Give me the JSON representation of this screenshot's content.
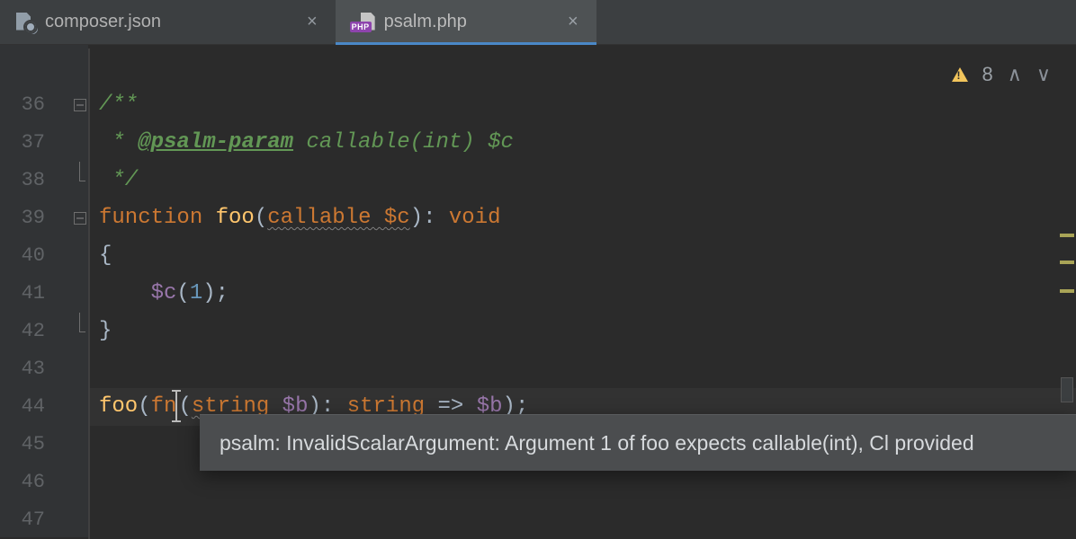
{
  "tabs": {
    "inactive": {
      "label": "composer.json"
    },
    "active": {
      "label": "psalm.php",
      "badge": "PHP"
    }
  },
  "inspections": {
    "warning_count": "8"
  },
  "gutter": {
    "l35": " ",
    "l36": "36",
    "l37": "37",
    "l38": "38",
    "l39": "39",
    "l40": "40",
    "l41": "41",
    "l42": "42",
    "l43": "43",
    "l44": "44",
    "l45": "45",
    "l46": "46",
    "l47": "47"
  },
  "code": {
    "l36": {
      "a": "/**"
    },
    "l37": {
      "a": " * ",
      "tag": "@psalm-param",
      "b": " callable(int) $c"
    },
    "l38": {
      "a": " */"
    },
    "l39": {
      "kw": "function ",
      "fn": "foo",
      "p1": "(",
      "param": "callable $c",
      "p2": "): ",
      "ret": "void"
    },
    "l40": {
      "a": "{"
    },
    "l41": {
      "pad": "    ",
      "var": "$c",
      "p1": "(",
      "num": "1",
      "p2": ");"
    },
    "l42": {
      "a": "}"
    },
    "l44": {
      "fn": "foo",
      "p1": "(",
      "kw": "fn",
      "p1b": "(",
      "t1": "string",
      "sp1": " ",
      "v1": "$b",
      "p2": "): ",
      "t2": "string",
      "arr": " => ",
      "v2": "$b",
      "p3": ");"
    }
  },
  "tooltip": {
    "text": "psalm: InvalidScalarArgument: Argument 1 of foo expects callable(int), Cl provided"
  }
}
